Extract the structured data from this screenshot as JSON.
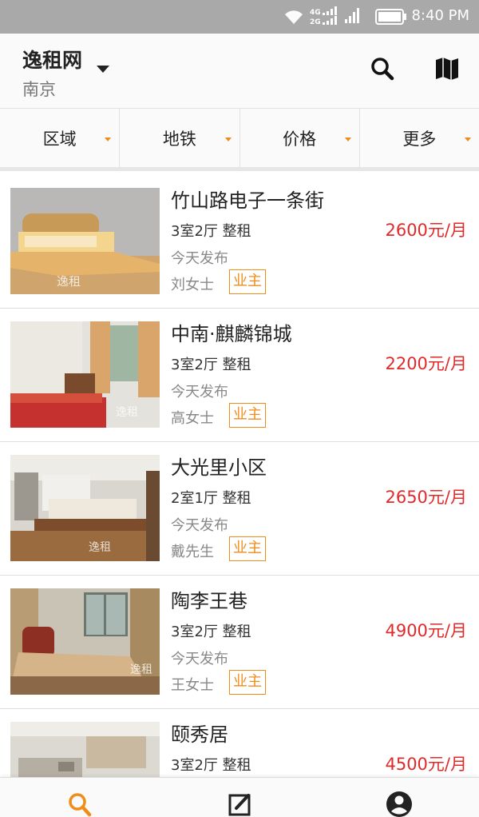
{
  "status_bar": {
    "time": "8:40 PM",
    "icons": [
      "wifi-icon",
      "signal-4g-2g-icon",
      "signal-icon",
      "battery-icon"
    ],
    "network_labels": [
      "4G",
      "2G"
    ]
  },
  "header": {
    "title": "逸租网",
    "city": "南京",
    "icons": [
      "search-icon",
      "map-icon"
    ]
  },
  "filters": [
    {
      "label": "区域"
    },
    {
      "label": "地铁"
    },
    {
      "label": "价格"
    },
    {
      "label": "更多"
    }
  ],
  "listings": [
    {
      "title": "竹山路电子一条街",
      "layout": "3室2厅 整租",
      "price": "2600元/月",
      "posted": "今天发布",
      "contact": "刘女士",
      "badge": "业主",
      "watermark": "逸租"
    },
    {
      "title": "中南·麒麟锦城",
      "layout": "3室2厅 整租",
      "price": "2200元/月",
      "posted": "今天发布",
      "contact": "高女士",
      "badge": "业主",
      "watermark": "逸租"
    },
    {
      "title": "大光里小区",
      "layout": "2室1厅 整租",
      "price": "2650元/月",
      "posted": "今天发布",
      "contact": "戴先生",
      "badge": "业主",
      "watermark": "逸租"
    },
    {
      "title": "陶李王巷",
      "layout": "3室2厅 整租",
      "price": "4900元/月",
      "posted": "今天发布",
      "contact": "王女士",
      "badge": "业主",
      "watermark": "逸租"
    },
    {
      "title": "颐秀居",
      "layout": "3室2厅 整租",
      "price": "4500元/月",
      "posted": "",
      "contact": "",
      "badge": ""
    }
  ],
  "bottom_nav": {
    "icons": [
      "search-icon",
      "edit-icon",
      "account-icon"
    ],
    "active": "search-icon"
  },
  "colors": {
    "accent": "#f08c1a",
    "price": "#e02a2a",
    "status_bar": "#a9a9a9"
  }
}
